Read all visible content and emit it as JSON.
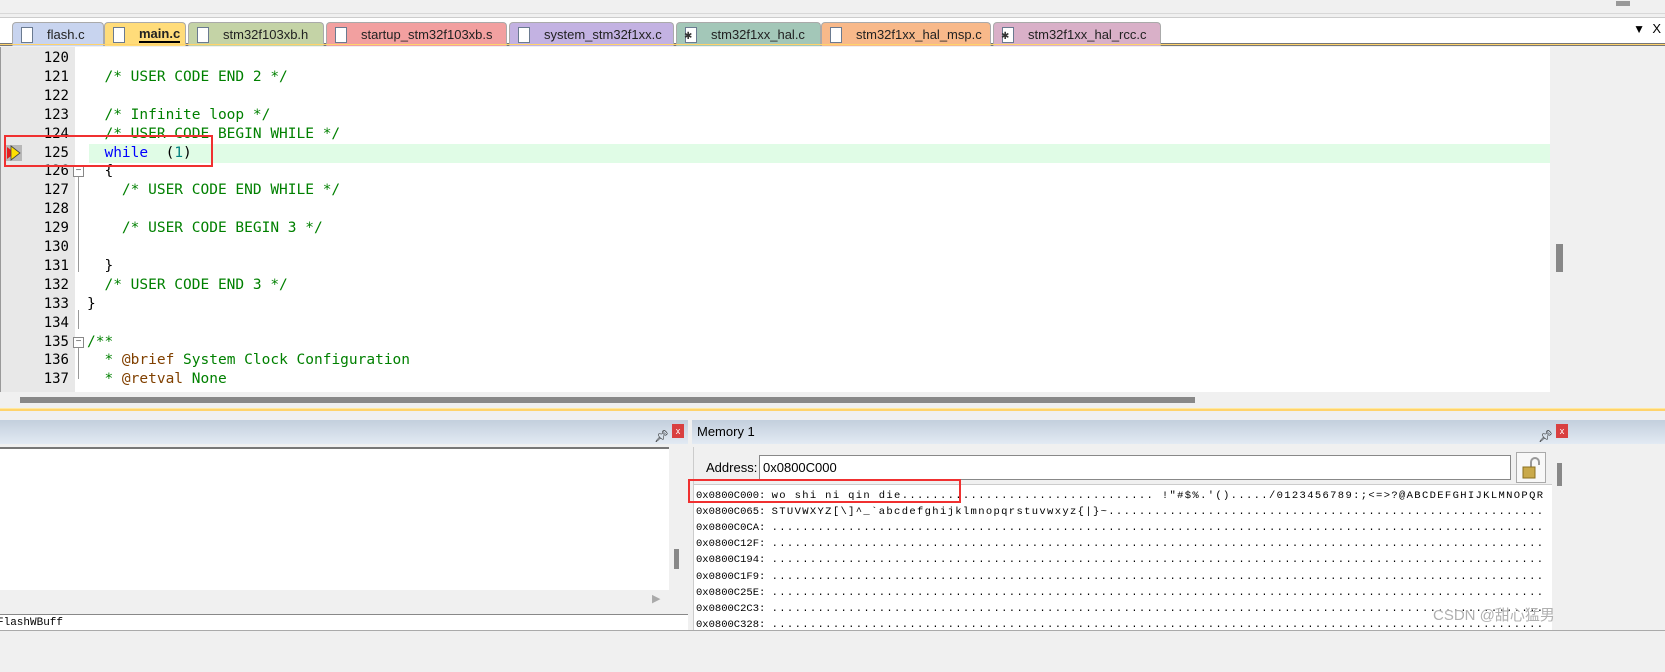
{
  "tabs": [
    {
      "label": "flash.c",
      "color": "#c8d4ef",
      "icon": "file-icon"
    },
    {
      "label": "main.c",
      "color": "#ffdc7a",
      "icon": "file-icon",
      "active": true
    },
    {
      "label": "stm32f103xb.h",
      "color": "#c4d3a6",
      "icon": "file-icon"
    },
    {
      "label": "startup_stm32f103xb.s",
      "color": "#f2a0a0",
      "icon": "file-icon"
    },
    {
      "label": "system_stm32f1xx.c",
      "color": "#c3b2e2",
      "icon": "file-icon"
    },
    {
      "label": "stm32f1xx_hal.c",
      "color": "#a3c7b8",
      "icon": "gear-file-icon"
    },
    {
      "label": "stm32f1xx_hal_msp.c",
      "color": "#f8b98a",
      "icon": "file-icon"
    },
    {
      "label": "stm32f1xx_hal_rcc.c",
      "color": "#d9b0c8",
      "icon": "gear-file-icon"
    }
  ],
  "tab_menu_icon": "▼",
  "tab_close_icon": "X",
  "editor": {
    "current_line": 125,
    "lines": [
      {
        "n": "120",
        "segs": []
      },
      {
        "n": "121",
        "segs": [
          [
            "cm",
            "  /* USER CODE END 2 */"
          ]
        ]
      },
      {
        "n": "122",
        "segs": []
      },
      {
        "n": "123",
        "segs": [
          [
            "cm",
            "  /* Infinite loop */"
          ]
        ]
      },
      {
        "n": "124",
        "segs": [
          [
            "cm",
            "  /* USER CODE BEGIN WHILE */"
          ]
        ]
      },
      {
        "n": "125",
        "segs": [
          [
            "kw",
            "  while"
          ],
          [
            "",
            "  ("
          ],
          [
            "num",
            "1"
          ],
          [
            "",
            ")"
          ]
        ]
      },
      {
        "n": "126",
        "segs": [
          [
            "",
            "  {"
          ]
        ]
      },
      {
        "n": "127",
        "segs": [
          [
            "cm",
            "    /* USER CODE END WHILE */"
          ]
        ]
      },
      {
        "n": "128",
        "segs": []
      },
      {
        "n": "129",
        "segs": [
          [
            "cm",
            "    /* USER CODE BEGIN 3 */"
          ]
        ]
      },
      {
        "n": "130",
        "segs": []
      },
      {
        "n": "131",
        "segs": [
          [
            "",
            "  }"
          ]
        ]
      },
      {
        "n": "132",
        "segs": [
          [
            "cm",
            "  /* USER CODE END 3 */"
          ]
        ]
      },
      {
        "n": "133",
        "segs": [
          [
            "",
            "}"
          ]
        ]
      },
      {
        "n": "134",
        "segs": []
      },
      {
        "n": "135",
        "segs": [
          [
            "cm",
            "/**"
          ]
        ]
      },
      {
        "n": "136",
        "segs": [
          [
            "cm",
            "  * "
          ],
          [
            "tag",
            "@brief"
          ],
          [
            "cm",
            " System Clock Configuration"
          ]
        ]
      },
      {
        "n": "137",
        "segs": [
          [
            "cm",
            "  * "
          ],
          [
            "tag",
            "@retval"
          ],
          [
            "cm",
            " None"
          ]
        ]
      }
    ]
  },
  "left_panel": {
    "input_value": "FlashWBuff"
  },
  "memory": {
    "title": "Memory 1",
    "address_label": "Address:",
    "address_value": "0x0800C000",
    "rows": [
      {
        "addr": "0x0800C000:",
        "data": "wo shi ni qin die................................. !\"#$%.'()...../0123456789:;<=>?@ABCDEFGHIJKLMNOPQR"
      },
      {
        "addr": "0x0800C065:",
        "data": "STUVWXYZ[\\]^_`abcdefghijklmnopqrstuvwxyz{|}~........................................................."
      },
      {
        "addr": "0x0800C0CA:",
        "data": "....................................................................................................."
      },
      {
        "addr": "0x0800C12F:",
        "data": "....................................................................................................."
      },
      {
        "addr": "0x0800C194:",
        "data": "....................................................................................................."
      },
      {
        "addr": "0x0800C1F9:",
        "data": "....................................................................................................."
      },
      {
        "addr": "0x0800C25E:",
        "data": "....................................................................................................."
      },
      {
        "addr": "0x0800C2C3:",
        "data": "....................................................................................................."
      },
      {
        "addr": "0x0800C328:",
        "data": "....................................................................................................."
      }
    ]
  },
  "watermark": "CSDN @甜心猛男",
  "highlight_color": "#f03030"
}
